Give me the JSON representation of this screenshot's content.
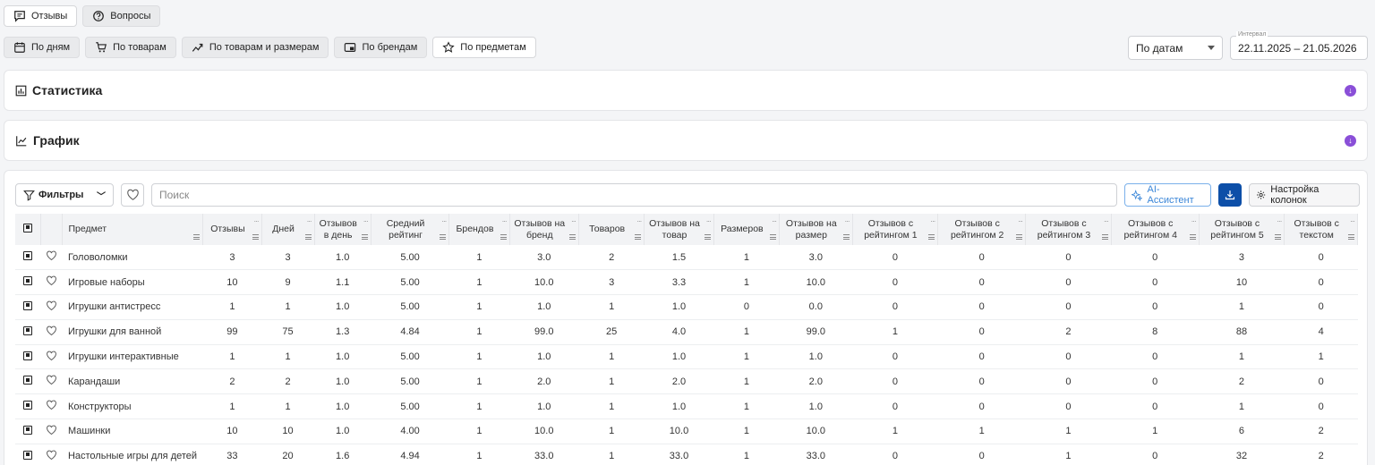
{
  "top_tabs": [
    {
      "label": "Отзывы",
      "icon": "chat-icon",
      "active": true
    },
    {
      "label": "Вопросы",
      "icon": "question-icon",
      "active": false
    }
  ],
  "view_tabs": [
    {
      "label": "По дням",
      "icon": "calendar-icon",
      "active": false
    },
    {
      "label": "По товарам",
      "icon": "cart-icon",
      "active": false
    },
    {
      "label": "По товарам и размерам",
      "icon": "chart-trend-icon",
      "active": false
    },
    {
      "label": "По брендам",
      "icon": "brand-icon",
      "active": false
    },
    {
      "label": "По предметам",
      "icon": "star-icon",
      "active": true
    }
  ],
  "period": {
    "select_value": "По датам",
    "interval_label": "Интервал",
    "interval_value": "22.11.2025 – 21.05.2026"
  },
  "panels": {
    "stats_title": "Статистика",
    "chart_title": "График"
  },
  "toolbar": {
    "filters_label": "Фильтры",
    "search_placeholder": "Поиск",
    "ai_label": "AI-Ассистент",
    "columns_label": "Настройка колонок"
  },
  "colors": {
    "accent": "#0d4fa8",
    "purple": "#8a4fd8",
    "ai": "#3a86d8"
  },
  "table": {
    "headers": [
      "Предмет",
      "Отзывы",
      "Дней",
      "Отзывов в день",
      "Средний рейтинг",
      "Брендов",
      "Отзывов на бренд",
      "Товаров",
      "Отзывов на товар",
      "Размеров",
      "Отзывов на размер",
      "Отзывов с рейтингом 1",
      "Отзывов с рейтингом 2",
      "Отзывов с рейтингом 3",
      "Отзывов с рейтингом 4",
      "Отзывов с рейтингом 5",
      "Отзывов с текстом"
    ],
    "rows": [
      [
        "Головоломки",
        "3",
        "3",
        "1.0",
        "5.00",
        "1",
        "3.0",
        "2",
        "1.5",
        "1",
        "3.0",
        "0",
        "0",
        "0",
        "0",
        "3",
        "0"
      ],
      [
        "Игровые наборы",
        "10",
        "9",
        "1.1",
        "5.00",
        "1",
        "10.0",
        "3",
        "3.3",
        "1",
        "10.0",
        "0",
        "0",
        "0",
        "0",
        "10",
        "0"
      ],
      [
        "Игрушки антистресс",
        "1",
        "1",
        "1.0",
        "5.00",
        "1",
        "1.0",
        "1",
        "1.0",
        "0",
        "0.0",
        "0",
        "0",
        "0",
        "0",
        "1",
        "0"
      ],
      [
        "Игрушки для ванной",
        "99",
        "75",
        "1.3",
        "4.84",
        "1",
        "99.0",
        "25",
        "4.0",
        "1",
        "99.0",
        "1",
        "0",
        "2",
        "8",
        "88",
        "4"
      ],
      [
        "Игрушки интерактивные",
        "1",
        "1",
        "1.0",
        "5.00",
        "1",
        "1.0",
        "1",
        "1.0",
        "1",
        "1.0",
        "0",
        "0",
        "0",
        "0",
        "1",
        "1"
      ],
      [
        "Карандаши",
        "2",
        "2",
        "1.0",
        "5.00",
        "1",
        "2.0",
        "1",
        "2.0",
        "1",
        "2.0",
        "0",
        "0",
        "0",
        "0",
        "2",
        "0"
      ],
      [
        "Конструкторы",
        "1",
        "1",
        "1.0",
        "5.00",
        "1",
        "1.0",
        "1",
        "1.0",
        "1",
        "1.0",
        "0",
        "0",
        "0",
        "0",
        "1",
        "0"
      ],
      [
        "Машинки",
        "10",
        "10",
        "1.0",
        "4.00",
        "1",
        "10.0",
        "1",
        "10.0",
        "1",
        "10.0",
        "1",
        "1",
        "1",
        "1",
        "6",
        "2"
      ],
      [
        "Настольные игры для детей",
        "33",
        "20",
        "1.6",
        "4.94",
        "1",
        "33.0",
        "1",
        "33.0",
        "1",
        "33.0",
        "0",
        "0",
        "1",
        "0",
        "32",
        "2"
      ]
    ]
  }
}
